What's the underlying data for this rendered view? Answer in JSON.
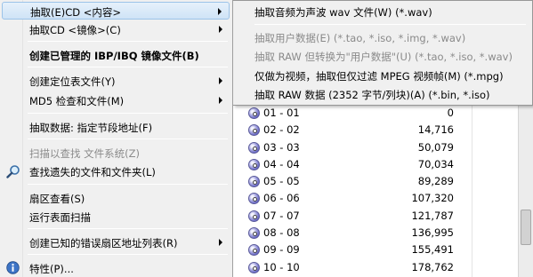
{
  "menu": {
    "items": [
      {
        "label": "抽取(E)CD  <内容>",
        "submenu": true,
        "highlight": true
      },
      {
        "label": "抽取CD  <镜像>(C)",
        "submenu": true
      },
      {
        "label": "创建已管理的 IBP/IBQ 镜像文件(B)",
        "bold": true
      },
      {
        "label": "创建定位表文件(Y)",
        "submenu": true
      },
      {
        "label": "MD5 检查和文件(M)",
        "submenu": true
      },
      {
        "label": "抽取数据: 指定节段地址(F)"
      },
      {
        "label": "扫描以查找 文件系统(Z)",
        "disabled": true
      },
      {
        "label": "查找遗失的文件和文件夹(L)",
        "icon": "search-icon"
      },
      {
        "label": "扇区查看(S)"
      },
      {
        "label": "运行表面扫描"
      },
      {
        "label": "创建已知的错误扇区地址列表(R)",
        "submenu": true
      },
      {
        "label": "特性(P)...",
        "icon": "info-icon"
      }
    ]
  },
  "submenu": {
    "items": [
      {
        "label": "抽取音频为声波 wav 文件(W) (*.wav)"
      },
      {
        "label": "抽取用户数据(E) (*.tao, *.iso, *.img, *.wav)",
        "disabled": true
      },
      {
        "label": "抽取 RAW 但转换为\"用户数据\"(U) (*.tao, *.iso, *.wav)",
        "disabled": true
      },
      {
        "label": "仅做为视频，抽取但仅过滤 MPEG 视频帧(M) (*.mpg)"
      },
      {
        "label": "抽取 RAW 数据 (2352 字节/列块)(A) (*.bin, *.iso)"
      }
    ]
  },
  "tracks": [
    {
      "name": "01 - 01",
      "size": "0"
    },
    {
      "name": "02 - 02",
      "size": "14,716"
    },
    {
      "name": "03 - 03",
      "size": "50,079"
    },
    {
      "name": "04 - 04",
      "size": "70,034"
    },
    {
      "name": "05 - 05",
      "size": "89,289"
    },
    {
      "name": "06 - 06",
      "size": "107,320"
    },
    {
      "name": "07 - 07",
      "size": "121,787"
    },
    {
      "name": "08 - 08",
      "size": "136,995"
    },
    {
      "name": "09 - 09",
      "size": "155,491"
    },
    {
      "name": "10 - 10",
      "size": "178,762"
    }
  ]
}
